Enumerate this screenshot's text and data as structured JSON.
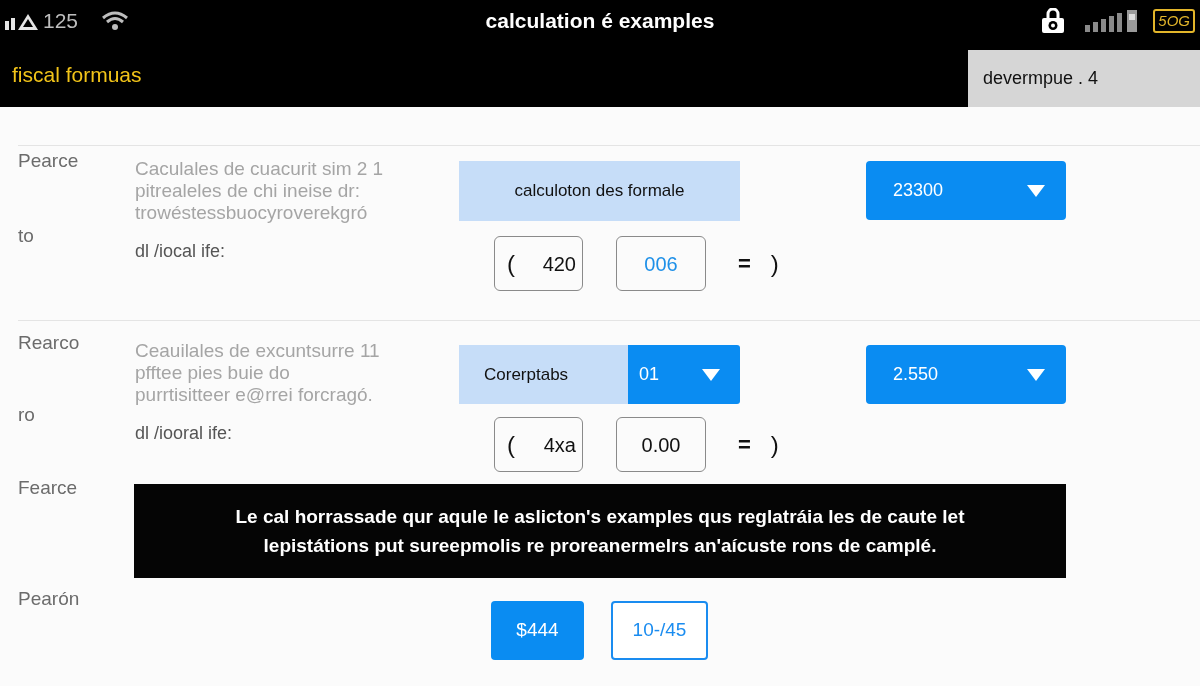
{
  "status_bar": {
    "signal_text": "125",
    "title": "calculation é examples",
    "network": "5OG"
  },
  "header": {
    "title": "fiscal formuas",
    "tab": "devermpue . 4"
  },
  "sections": [
    {
      "labels": [
        "Pearce",
        "to"
      ],
      "description": [
        "Caculales de cuacurit sim  2 1",
        "pitrealeles de chi ineise dr:",
        "trowéstessbuocyroverekgró"
      ],
      "note": "dl /iocal ife:",
      "control": {
        "kind": "label",
        "label": "calculoton des formale"
      },
      "dropdown": "23300",
      "inputs": [
        {
          "prefix": "(",
          "value": "420",
          "highlighted": false
        },
        {
          "value": "006",
          "highlighted": true
        }
      ],
      "operator": "=",
      "result": ")"
    },
    {
      "labels": [
        "Rearco",
        "ro"
      ],
      "description": [
        "Ceauilales de excuntsurre 11",
        "pfftee pies buie do",
        "purrtisitteer e@rrei forcragó."
      ],
      "note": "dl /iooral ife:",
      "control": {
        "kind": "split",
        "label": "Corerptabs",
        "value": "01"
      },
      "dropdown": "2.550",
      "inputs": [
        {
          "prefix": "(",
          "value": "4xa",
          "highlighted": false
        },
        {
          "value": "0.00",
          "highlighted": false
        }
      ],
      "operator": "=",
      "result": ")"
    }
  ],
  "notice": {
    "label": "Fearce",
    "lines": [
      "Le cal horrassade qur aqule le aslicton's examples qus reglatráia les de caute let",
      "lepistátions put sureepmolis re proreanermelrs an'aícuste rons de camplé."
    ]
  },
  "actions": {
    "label": "Pearón",
    "buttons": [
      {
        "label": "$444",
        "primary": true
      },
      {
        "label": "10-/45",
        "primary": false
      }
    ]
  }
}
